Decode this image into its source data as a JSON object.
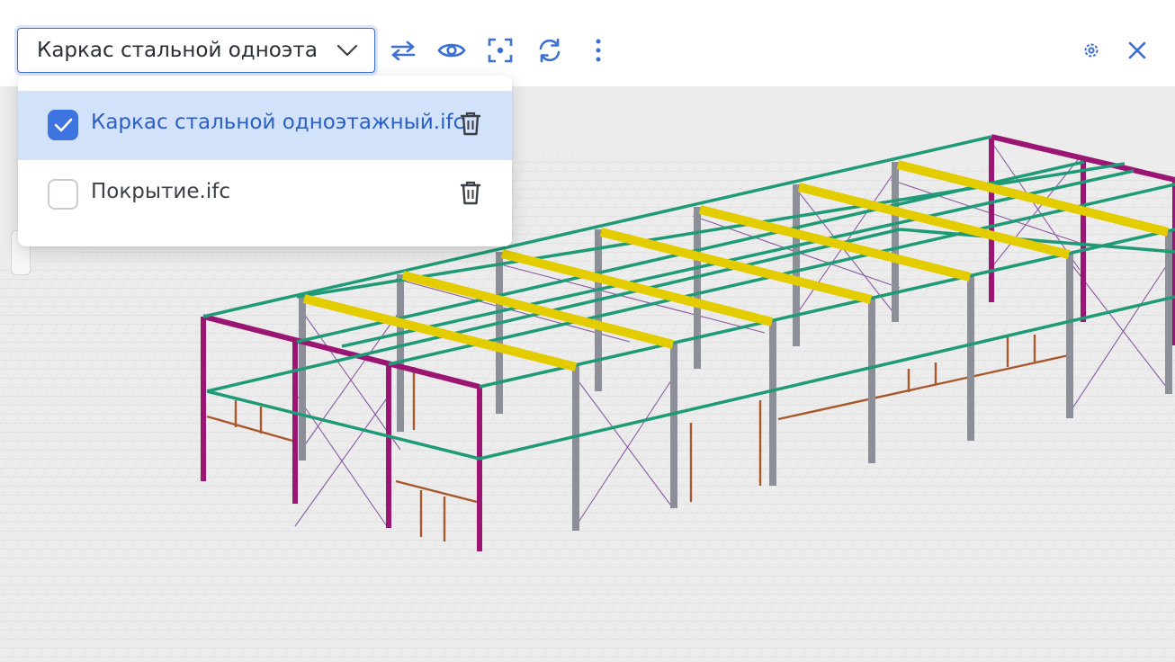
{
  "toolbar": {
    "model_select_value": "Каркас стальной одноэта",
    "icons": [
      "swap-arrows-icon",
      "eye-icon",
      "focus-frame-icon",
      "refresh-icon",
      "more-vertical-icon",
      "settings-gear-icon",
      "close-icon"
    ]
  },
  "dropdown": {
    "options": [
      {
        "label": "Каркас стальной одноэтажный.ifc",
        "checked": true
      },
      {
        "label": "Покрытие.ifc",
        "checked": false
      }
    ]
  },
  "colors": {
    "accent": "#3b6fd6",
    "selected_bg": "#d2e2fb",
    "beam_green": "#1f9a76",
    "purlin_yellow": "#e3cc00",
    "column_magenta": "#9b1672",
    "column_gray": "#8c8e98",
    "brace_purple": "#8a5aa0",
    "girt_brown": "#a8582a"
  }
}
